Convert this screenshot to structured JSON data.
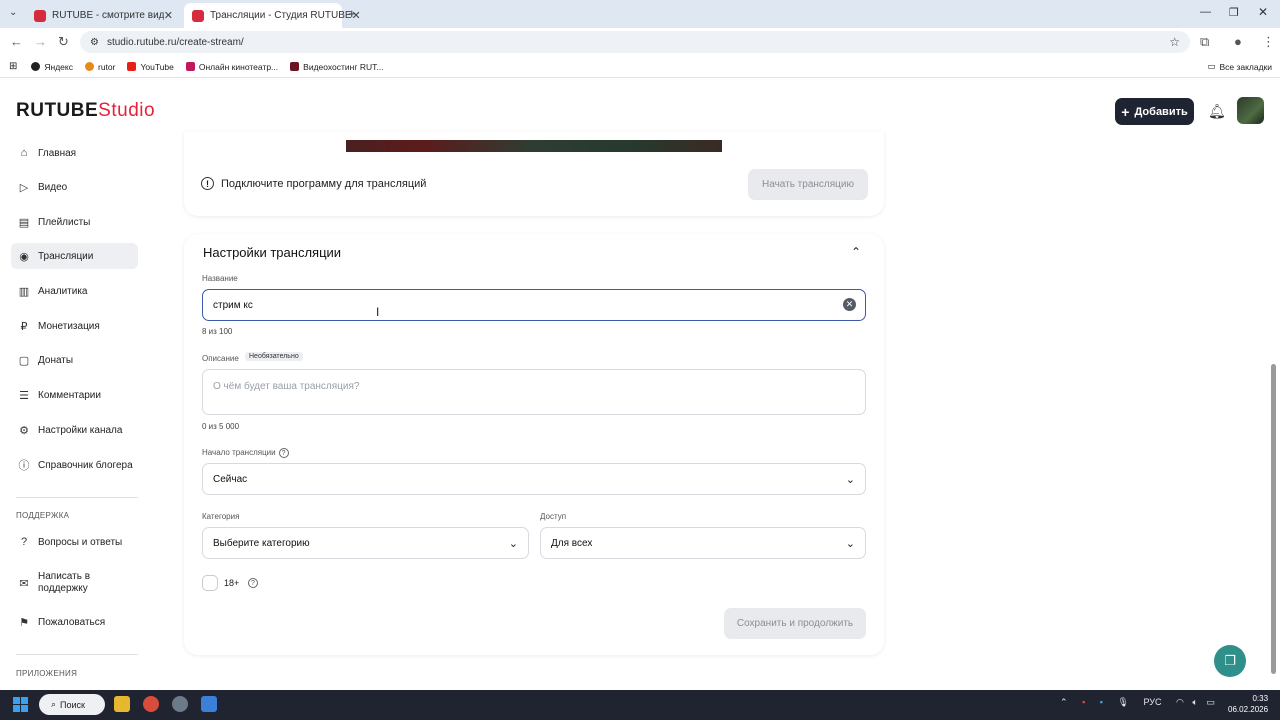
{
  "browser": {
    "tabs": [
      {
        "title": "RUTUBE - смотрите видео онл",
        "active": false
      },
      {
        "title": "Трансляции - Студия RUTUBE",
        "active": true
      }
    ],
    "url": "studio.rutube.ru/create-stream/",
    "bookmarks": [
      "Яндекс",
      "rutor",
      "YouTube",
      "Онлайн кинотеатр...",
      "Видеохостинг RUT..."
    ],
    "all_bookmarks": "Все закладки"
  },
  "header": {
    "logo_main": "RUTUBE",
    "logo_studio": "Studio",
    "add_button": "Добавить"
  },
  "sidebar": {
    "items": [
      {
        "label": "Главная",
        "icon": "home-icon"
      },
      {
        "label": "Видео",
        "icon": "video-icon"
      },
      {
        "label": "Плейлисты",
        "icon": "playlist-icon"
      },
      {
        "label": "Трансляции",
        "icon": "broadcast-icon",
        "active": true
      },
      {
        "label": "Аналитика",
        "icon": "analytics-icon"
      },
      {
        "label": "Монетизация",
        "icon": "monetization-icon"
      },
      {
        "label": "Донаты",
        "icon": "donate-icon"
      },
      {
        "label": "Комментарии",
        "icon": "comments-icon"
      },
      {
        "label": "Настройки канала",
        "icon": "settings-icon"
      },
      {
        "label": "Справочник блогера",
        "icon": "info-icon"
      }
    ],
    "support_title": "ПОДДЕРЖКА",
    "support_items": [
      {
        "label": "Вопросы и ответы",
        "icon": "question-icon"
      },
      {
        "label": "Написать в поддержку",
        "icon": "mail-icon"
      },
      {
        "label": "Пожаловаться",
        "icon": "flag-icon"
      }
    ],
    "apps_title": "ПРИЛОЖЕНИЯ"
  },
  "stream": {
    "connect_text": "Подключите программу для трансляций",
    "start_button": "Начать трансляцию"
  },
  "settings": {
    "title": "Настройки трансляции",
    "name_label": "Название",
    "name_value": "стрим кс",
    "name_counter": "8 из 100",
    "desc_label": "Описание",
    "desc_optional": "Необязательно",
    "desc_placeholder": "О чём будет ваша трансляция?",
    "desc_counter": "0 из 5 000",
    "start_label": "Начало трансляции",
    "start_value": "Сейчас",
    "category_label": "Категория",
    "category_value": "Выберите категорию",
    "access_label": "Доступ",
    "access_value": "Для всех",
    "age_label": "18+",
    "save_button": "Сохранить и продолжить"
  },
  "taskbar": {
    "search": "Поиск",
    "lang": "РУС",
    "time": "0:33",
    "date": "06.02.2026"
  },
  "colors": {
    "brand_red": "#e3223b",
    "dark_button": "#1e2432",
    "focus_blue": "#3b5baa",
    "fab_teal": "#2f8f8a"
  }
}
